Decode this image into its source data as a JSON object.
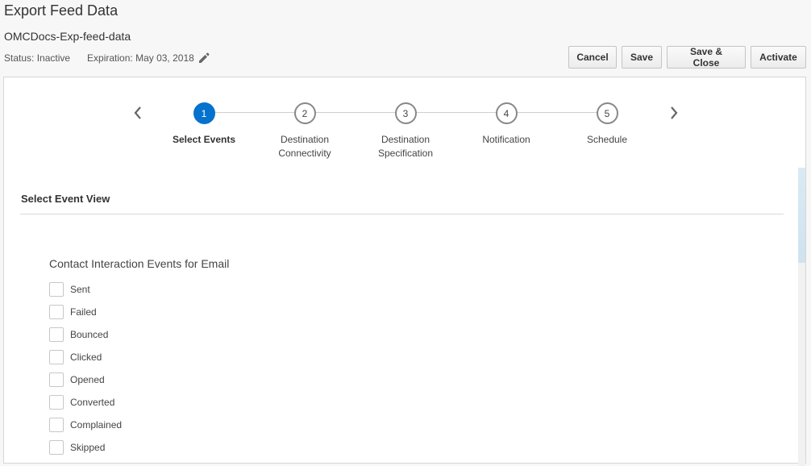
{
  "header": {
    "title": "Export Feed Data",
    "feed_name": "OMCDocs-Exp-feed-data",
    "status": "Status: Inactive",
    "expiration": "Expiration: May 03, 2018"
  },
  "actions": {
    "cancel": "Cancel",
    "save": "Save",
    "save_close": "Save & Close",
    "activate": "Activate"
  },
  "train": {
    "steps": [
      {
        "number": "1",
        "line1": "Select Events",
        "line2": ""
      },
      {
        "number": "2",
        "line1": "Destination",
        "line2": "Connectivity"
      },
      {
        "number": "3",
        "line1": "Destination",
        "line2": "Specification"
      },
      {
        "number": "4",
        "line1": "Notification",
        "line2": ""
      },
      {
        "number": "5",
        "line1": "Schedule",
        "line2": ""
      }
    ],
    "active_step": 1
  },
  "section": {
    "header": "Select Event View",
    "group_title": "Contact Interaction Events for Email",
    "events": [
      "Sent",
      "Failed",
      "Bounced",
      "Clicked",
      "Opened",
      "Converted",
      "Complained",
      "Skipped"
    ]
  },
  "colors": {
    "accent": "#0572ce"
  },
  "icons": [
    "pencil-icon",
    "chevron-left-icon",
    "chevron-right-icon"
  ]
}
